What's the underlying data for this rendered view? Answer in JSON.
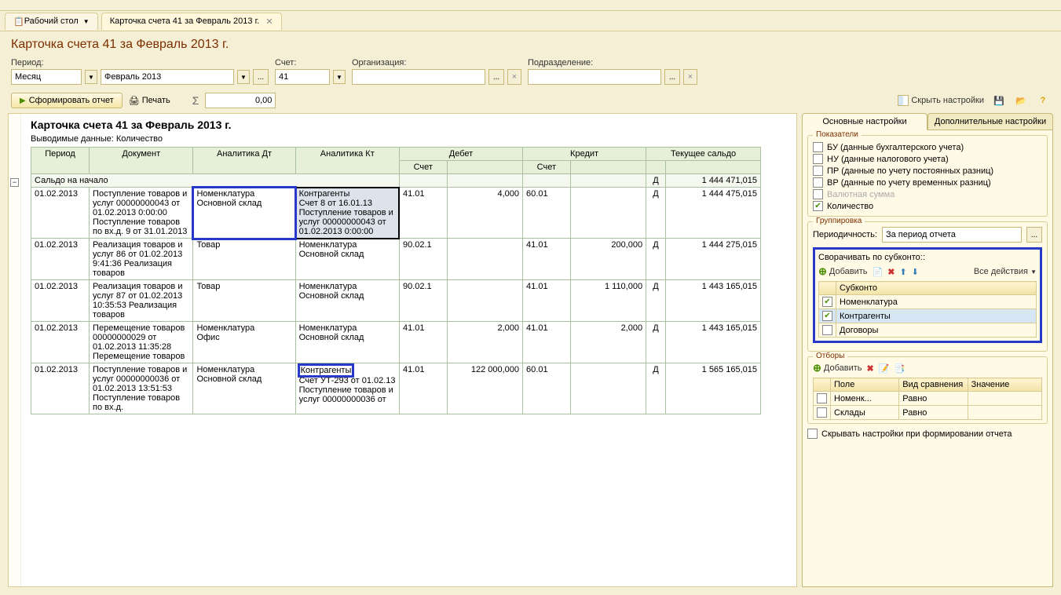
{
  "tabs": {
    "desktop": "Рабочий стол",
    "card": "Карточка счета 41 за Февраль 2013 г."
  },
  "header": "Карточка счета 41 за Февраль 2013 г.",
  "filters": {
    "period_label": "Период:",
    "period_type": "Месяц",
    "period_value": "Февраль 2013",
    "account_label": "Счет:",
    "account_value": "41",
    "org_label": "Организация:",
    "org_value": "",
    "division_label": "Подразделение:",
    "division_value": ""
  },
  "actions": {
    "form_report": "Сформировать отчет",
    "print": "Печать",
    "sum_value": "0,00",
    "hide_settings": "Скрыть настройки"
  },
  "report": {
    "title": "Карточка счета 41 за Февраль 2013 г.",
    "output_data_label": "Выводимые данные:",
    "output_data_value": "Количество",
    "columns": {
      "period": "Период",
      "document": "Документ",
      "analytics_dt": "Аналитика Дт",
      "analytics_kt": "Аналитика Кт",
      "debit": "Дебет",
      "credit": "Кредит",
      "account": "Счет",
      "current_balance": "Текущее сальдо"
    },
    "saldo_start": "Сальдо на начало",
    "saldo_start_dk": "Д",
    "saldo_start_val": "1 444 471,015",
    "rows": [
      {
        "date": "01.02.2013",
        "doc": "Поступление товаров и услуг 00000000043 от 01.02.2013 0:00:00 Поступление товаров по вх.д. 9 от 31.01.2013",
        "adt": "Номенклатура\nОсновной склад",
        "akt": "Контрагенты\nСчет 8 от 16.01.13\nПоступление товаров и услуг 00000000043 от 01.02.2013 0:00:00",
        "d_acc": "41.01",
        "d_amt": "4,000",
        "c_acc": "60.01",
        "c_amt": "",
        "dk": "Д",
        "sal": "1 444 475,015",
        "h_adt": true,
        "h_akt": true
      },
      {
        "date": "01.02.2013",
        "doc": "Реализация товаров и услуг 86 от 01.02.2013 9:41:36 Реализация товаров",
        "adt": "Товар",
        "akt": "Номенклатура\nОсновной склад",
        "d_acc": "90.02.1",
        "d_amt": "",
        "c_acc": "41.01",
        "c_amt": "200,000",
        "dk": "Д",
        "sal": "1 444 275,015"
      },
      {
        "date": "01.02.2013",
        "doc": "Реализация товаров и услуг 87 от 01.02.2013 10:35:53 Реализация товаров",
        "adt": "Товар",
        "akt": "Номенклатура\nОсновной склад",
        "d_acc": "90.02.1",
        "d_amt": "",
        "c_acc": "41.01",
        "c_amt": "1 110,000",
        "dk": "Д",
        "sal": "1 443 165,015"
      },
      {
        "date": "01.02.2013",
        "doc": "Перемещение товаров 00000000029 от 01.02.2013 11:35:28 Перемещение товаров",
        "adt": "Номенклатура\nОфис",
        "akt": "Номенклатура\nОсновной склад",
        "d_acc": "41.01",
        "d_amt": "2,000",
        "c_acc": "41.01",
        "c_amt": "2,000",
        "dk": "Д",
        "sal": "1 443 165,015"
      },
      {
        "date": "01.02.2013",
        "doc": "Поступление товаров и услуг 00000000036 от 01.02.2013 13:51:53 Поступление товаров по вх.д.",
        "adt": "Номенклатура\nОсновной склад",
        "akt": "Контрагенты\nСчет УТ-293 от 01.02.13\nПоступление товаров и услуг 00000000036 от",
        "d_acc": "41.01",
        "d_amt": "122 000,000",
        "c_acc": "60.01",
        "c_amt": "",
        "dk": "Д",
        "sal": "1 565 165,015",
        "h_akt2": true
      }
    ]
  },
  "settings": {
    "tab_main": "Основные настройки",
    "tab_extra": "Дополнительные настройки",
    "indicators_legend": "Показатели",
    "indicators": [
      {
        "label": "БУ (данные бухгалтерского учета)",
        "checked": false
      },
      {
        "label": "НУ (данные налогового учета)",
        "checked": false
      },
      {
        "label": "ПР (данные по учету постоянных разниц)",
        "checked": false
      },
      {
        "label": "ВР (данные по учету временных разниц)",
        "checked": false
      },
      {
        "label": "Валютная сумма",
        "checked": false,
        "disabled": true
      },
      {
        "label": "Количество",
        "checked": true
      }
    ],
    "grouping_legend": "Группировка",
    "periodicity_label": "Периодичность:",
    "periodicity_value": "За период отчета",
    "collapse_label": "Сворачивать по субконто::",
    "add_btn": "Добавить",
    "all_actions": "Все действия",
    "subkonto_header": "Субконто",
    "subkonto": [
      {
        "label": "Номенклатура",
        "checked": true,
        "selected": false
      },
      {
        "label": "Контрагенты",
        "checked": true,
        "selected": true
      },
      {
        "label": "Договоры",
        "checked": false,
        "selected": false
      }
    ],
    "otbor_legend": "Отборы",
    "otbor_cols": {
      "field": "Поле",
      "cmp": "Вид сравнения",
      "val": "Значение"
    },
    "otbor_rows": [
      {
        "field": "Номенк...",
        "cmp": "Равно",
        "val": ""
      },
      {
        "field": "Склады",
        "cmp": "Равно",
        "val": ""
      }
    ],
    "hide_on_form": "Скрывать настройки при формировании отчета"
  }
}
